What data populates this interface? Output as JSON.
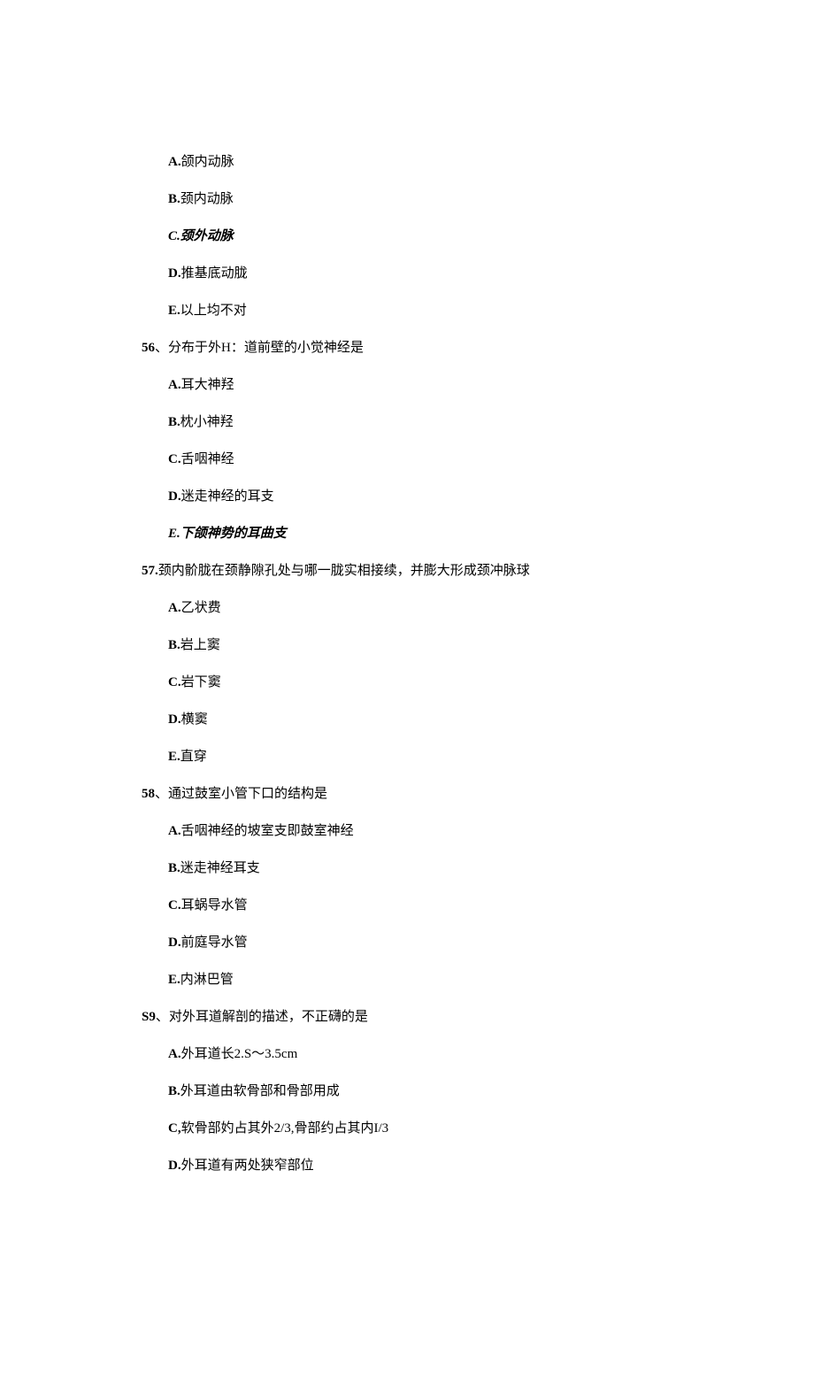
{
  "questions": [
    {
      "number": "",
      "text": "",
      "options": [
        {
          "label": "A.",
          "text": "颌内动脉",
          "italic": false
        },
        {
          "label": "B.",
          "text": "颈内动脉",
          "italic": false
        },
        {
          "label": "C.",
          "text": "颈外动脉",
          "italic": true
        },
        {
          "label": "D.",
          "text": "推基底动胧",
          "italic": false
        },
        {
          "label": "E.",
          "text": "以上均不对",
          "italic": false
        }
      ]
    },
    {
      "number": "56",
      "text": "、分布于外H：道前壁的小觉神经是",
      "options": [
        {
          "label": "A.",
          "text": "耳大神羟",
          "italic": false
        },
        {
          "label": "B.",
          "text": "枕小神羟",
          "italic": false
        },
        {
          "label": "C.",
          "text": "舌咽神经",
          "italic": false
        },
        {
          "label": "D.",
          "text": "迷走神经的耳支",
          "italic": false
        },
        {
          "label": "E.",
          "text": "下颌神势的耳曲支",
          "italic": true
        }
      ]
    },
    {
      "number": "57.",
      "text": "颈内骱胧在颈静隙孔处与哪一胧实相接续，并膨大形成颈冲脉球",
      "options": [
        {
          "label": "A.",
          "text": "乙状费",
          "italic": false
        },
        {
          "label": "B.",
          "text": "岩上窦",
          "italic": false
        },
        {
          "label": "C.",
          "text": "岩下窦",
          "italic": false
        },
        {
          "label": "D.",
          "text": "横窦",
          "italic": false
        },
        {
          "label": "E.",
          "text": "直穿",
          "italic": false
        }
      ]
    },
    {
      "number": "58",
      "text": "、通过鼓室小管下口的结构是",
      "options": [
        {
          "label": "A.",
          "text": "舌咽神经的坡室支即鼓室神经",
          "italic": false
        },
        {
          "label": "B.",
          "text": "迷走神经耳支",
          "italic": false
        },
        {
          "label": "C.",
          "text": "耳蜗导水管",
          "italic": false
        },
        {
          "label": "D.",
          "text": "前庭导水管",
          "italic": false
        },
        {
          "label": "E.",
          "text": "内淋巴管",
          "italic": false
        }
      ]
    },
    {
      "number": "S9",
      "text": "、对外耳道解剖的描述，不正礴的是",
      "options": [
        {
          "label": "A.",
          "text": "外耳道长2.S～3.5cm",
          "italic": false
        },
        {
          "label": "B.",
          "text": "外耳道由软骨部和骨部用成",
          "italic": false
        },
        {
          "label": "C,",
          "text": "软骨部妁占其外2/3,骨部约占其内I/3",
          "italic": false
        },
        {
          "label": "D.",
          "text": "外耳道有两处狭窄部位",
          "italic": false
        }
      ]
    }
  ]
}
